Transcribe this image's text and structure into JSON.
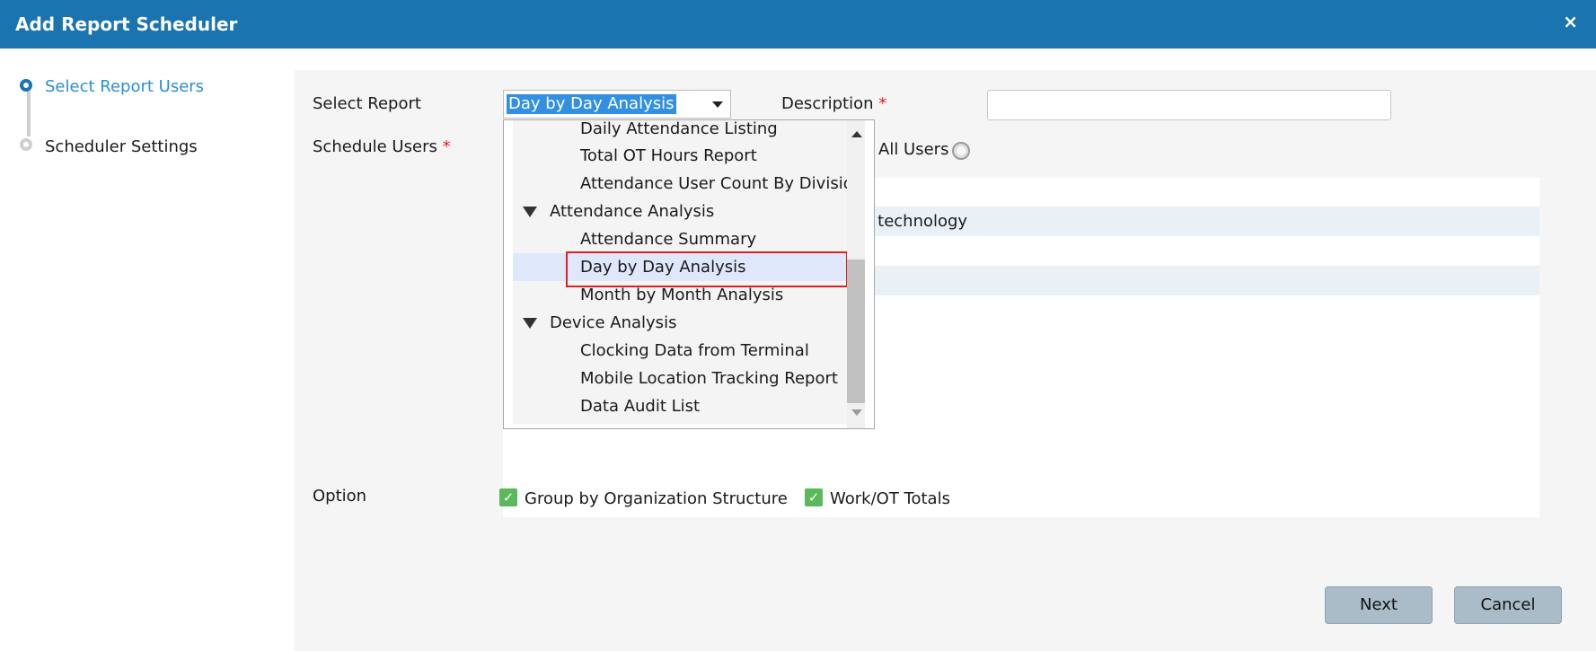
{
  "window": {
    "title": "Add Report Scheduler",
    "close_label": "×"
  },
  "steps": [
    {
      "label": "Select Report Users",
      "active": true
    },
    {
      "label": "Scheduler Settings",
      "active": false
    }
  ],
  "form": {
    "select_report_label": "Select Report",
    "select_report_value": "Day by Day Analysis",
    "description_label": "Description",
    "description_value": "",
    "required_mark": "*",
    "schedule_users_label": "Schedule Users",
    "all_users_label": "All Users",
    "visible_user_text": "n technology",
    "option_label": "Option",
    "options": [
      {
        "label": "Group by Organization Structure",
        "checked": true
      },
      {
        "label": "Work/OT Totals",
        "checked": true
      }
    ],
    "check_mark": "✓"
  },
  "dropdown": {
    "items": [
      {
        "label": "Daily Attendance Listing",
        "type": "child"
      },
      {
        "label": "Total OT Hours Report",
        "type": "child"
      },
      {
        "label": "Attendance User Count By Division",
        "type": "child"
      },
      {
        "label": "Attendance Analysis",
        "type": "group"
      },
      {
        "label": "Attendance Summary",
        "type": "child"
      },
      {
        "label": "Day by Day Analysis",
        "type": "child",
        "selected": true
      },
      {
        "label": "Month by Month Analysis",
        "type": "child"
      },
      {
        "label": "Device Analysis",
        "type": "group"
      },
      {
        "label": "Clocking Data from Terminal",
        "type": "child"
      },
      {
        "label": "Mobile Location Tracking Report",
        "type": "child"
      },
      {
        "label": "Data Audit List",
        "type": "child"
      }
    ]
  },
  "buttons": {
    "next": "Next",
    "cancel": "Cancel"
  },
  "colors": {
    "header": "#1a74b0",
    "active_step": "#2a8fd3",
    "required": "#e02020",
    "checkbox": "#5bb85b"
  }
}
